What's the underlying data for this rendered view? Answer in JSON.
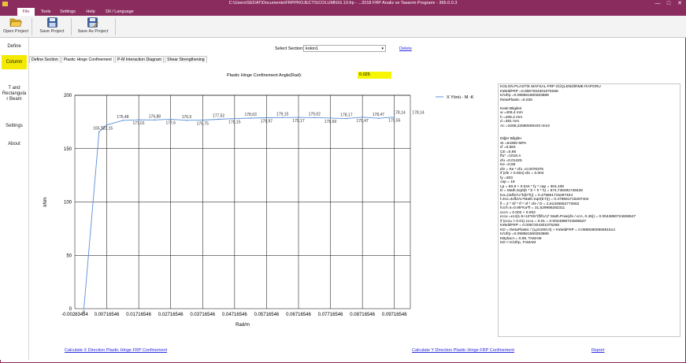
{
  "window": {
    "title": "C:\\Users\\SEDAT\\Documents\\FRPPROJECTS\\COLUMN16.10.frp - ...2018 FRP Analiz ve Tasarım Programı - 365.0.0.3",
    "controls": [
      "—",
      "□",
      "✕"
    ]
  },
  "menu": {
    "items": [
      "File",
      "Tools",
      "Settings",
      "Help",
      "Dil / Language"
    ],
    "active_index": 0
  },
  "toolbar": {
    "open_label": "Open Project",
    "save_label": "Save Project",
    "saveas_label": "Save As Project"
  },
  "sidebar": {
    "items": [
      "Define",
      "Column",
      "T and Rectangula r Beam",
      "Settings",
      "About"
    ],
    "active_index": 1
  },
  "section": {
    "label": "Select Section:",
    "value": "kolon1",
    "delete_label": "Delete"
  },
  "tabs": {
    "items": [
      "Define Section",
      "Plastic Hinge Confinement",
      "P-M Interaction Diagram",
      "Shear Strengthening"
    ],
    "active_index": 1
  },
  "angle": {
    "label": "Plastic Hinge Confinement Angle(Rad):",
    "value": "0.025"
  },
  "chart_data": {
    "type": "line",
    "xlabel": "Rad/m",
    "ylabel": "kNm",
    "ylim": [
      0,
      200
    ],
    "xlim": [
      -0.00283454,
      0.10216546
    ],
    "xticks": [
      "-0.00283454",
      "0.00716546",
      "0.01716546",
      "0.02716546",
      "0.03716546",
      "0.04716546",
      "0.05716546",
      "0.06716546",
      "0.07716546",
      "0.08716546",
      "0.09716546"
    ],
    "yticks": [
      "0",
      "50",
      "100",
      "150",
      "200"
    ],
    "grid": true,
    "legend": "top-right",
    "series": [
      {
        "name": "X Yönü - M -K",
        "color": "#5b8fd6",
        "x": [
          0.0,
          0.00476546,
          0.00716546,
          0.01216546,
          0.01716546,
          0.02216546,
          0.02716546,
          0.03216546,
          0.03716546,
          0.04216546,
          0.04716546,
          0.05216546,
          0.05716546,
          0.06216546,
          0.06716546,
          0.07216546,
          0.07716546,
          0.08216546,
          0.08716546,
          0.09216546,
          0.09716546
        ],
        "y": [
          0,
          165.72,
          172.15,
          176.48,
          177.01,
          176.88,
          177.6,
          176.5,
          176.75,
          177.52,
          178.15,
          178.63,
          178.97,
          179.15,
          179.17,
          179.02,
          178.69,
          178.17,
          179.47,
          178.47,
          179.55
        ],
        "labels": [
          "0",
          "165,72",
          "172,15",
          "176,48",
          "177,01",
          "176,88",
          "177,6",
          "176,5",
          "176,75",
          "177,52",
          "178,15",
          "178,63",
          "178,97",
          "179,15",
          "179,17",
          "179,02",
          "178,69",
          "178,17",
          "179,47",
          "178,47",
          "179,55"
        ]
      }
    ],
    "trailing_labels": [
      "178,14",
      "178,14"
    ]
  },
  "report": {
    "lines": [
      "KOLON PLASTİK MAFSAL FRP GÜÇLENDİRME RAPORU",
      "K¥ieldFRP =0.0067204301075268",
      "K/Ufrp =0.098561560283688",
      "thetaPlastic =0.025",
      "",
      "Kesit Bilgileri",
      "w =406,4 mm",
      "h =406,4 mm",
      "d =381 mm",
      "Ac =2268,22580509103 mm2",
      "",
      "",
      "Diğer Bilgiler",
      "SI =64300 MPA",
      "εf =0,584",
      "CE =0,95",
      "ffu* =1018.4",
      "εfu =0,01425",
      "Ke =0,55",
      " εfe = Ke * εfu =0.0078375",
      "if (εfe > 0.004) εfe = 0.004",
      "fy =303",
      "cap = 19",
      "Lp = 50.8 + 0.044 * fy * cap = 304,108",
      "D = Math.Sqrt(b * b + h * h) = 574,736391748426",
      "Ka=(4εfb/Ac*b(b*h)) = 0.479661715287404",
      "f=Ke=4εfb/Ac*Math.Sqrt(b-h)) = 0.479661715287404",
      " fl = 2 * Sf * tf * nf * εfe / D = 2,61345552772562",
      "fcc/f=4=0.95*Ka*fl = 31,529956282311",
      "εccA = 0.002 + 0.002",
      "εccu =εc4(1.5+12*Kb*(fl/fcA)* Math.Pow(εfe / εcA, 0.45)) = 0.0044890724606527",
      " if (εccu > 0.01) εccu = 0.01 = 0.0044890724606527",
      "K¥ieldFRP = 0.0067204301075268",
      "KD = thetaPlastic / (Lp/1000.0) + K¥ieldFRP = 0.0889280060681514",
      "K/Ufrp =0.098561560283688",
      "KByfacA = 0.08, TAMAM",
      "KD < K/Ufrp, TAMAM"
    ]
  },
  "bottom": {
    "calc_x_label": "Calculate X Direction Plastic Hinge FRP Confinement",
    "calc_y_label": "Calculate Y Direction Plastic Hinge FRP Confinement",
    "report_label": "Report"
  }
}
